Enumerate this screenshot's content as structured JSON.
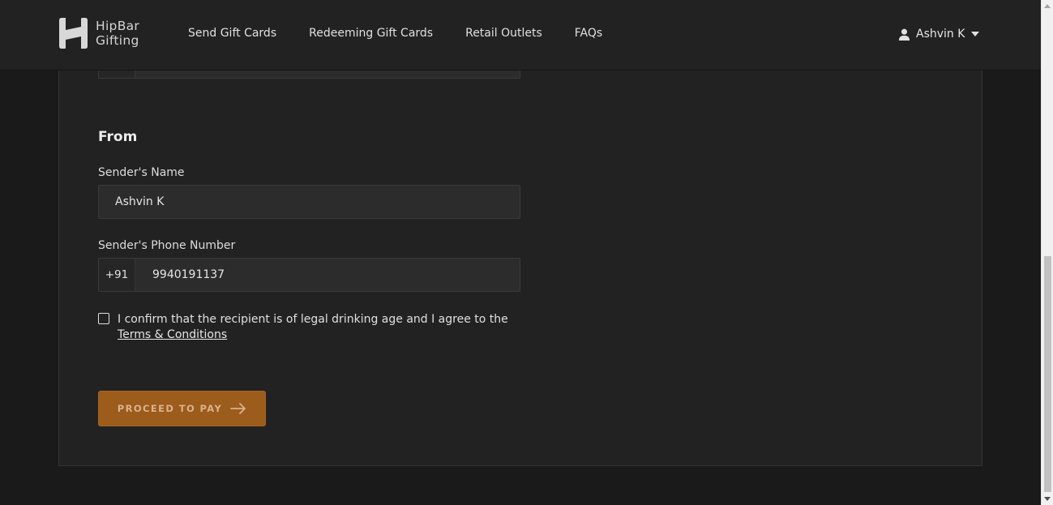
{
  "brand": {
    "name_line1": "HipBar",
    "name_line2": "Gifting"
  },
  "nav": {
    "items": [
      {
        "label": "Send Gift Cards"
      },
      {
        "label": "Redeeming Gift Cards"
      },
      {
        "label": "Retail Outlets"
      },
      {
        "label": "FAQs"
      }
    ]
  },
  "user": {
    "name": "Ashvin K"
  },
  "form": {
    "section_title": "From",
    "sender_name_label": "Sender's Name",
    "sender_name_value": "Ashvin K",
    "sender_phone_label": "Sender's Phone Number",
    "phone_prefix": "+91",
    "sender_phone_value": "9940191137",
    "consent_text": "I confirm that the recipient is of legal drinking age and I agree to the ",
    "consent_link": "Terms & Conditions",
    "consent_checked": false,
    "submit_label": "PROCEED TO PAY"
  },
  "colors": {
    "background": "#1a1a1b",
    "card": "#222223",
    "accent": "#9b5c1c"
  },
  "icons": {
    "user": "user-icon",
    "caret": "caret-down-icon",
    "arrow": "arrow-right-icon",
    "logo": "hipbar-logo-icon"
  }
}
